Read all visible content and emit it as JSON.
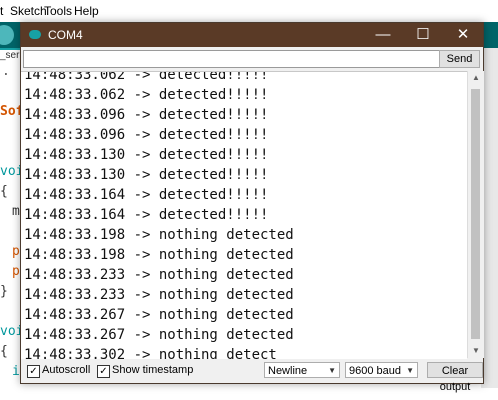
{
  "ide": {
    "menu": [
      "t",
      "Sketch",
      "Tools",
      "Help"
    ],
    "tab_label": "_ser",
    "code_fragments": [
      ".",
      "Sof",
      "voi",
      "{",
      "m",
      "p",
      "p",
      "}",
      "voi",
      "{",
      "i"
    ]
  },
  "window": {
    "title": "COM4",
    "minimize_glyph": "—",
    "maximize_glyph": "☐",
    "close_glyph": "✕"
  },
  "send": {
    "input_value": "",
    "button_label": "Send"
  },
  "output_lines": [
    "14:48:33.062 -> detected!!!!!",
    "14:48:33.062 -> detected!!!!!",
    "14:48:33.096 -> detected!!!!!",
    "14:48:33.096 -> detected!!!!!",
    "14:48:33.130 -> detected!!!!!",
    "14:48:33.130 -> detected!!!!!",
    "14:48:33.164 -> detected!!!!!",
    "14:48:33.164 -> detected!!!!!",
    "14:48:33.198 -> nothing detected",
    "14:48:33.198 -> nothing detected",
    "14:48:33.233 -> nothing detected",
    "14:48:33.233 -> nothing detected",
    "14:48:33.267 -> nothing detected",
    "14:48:33.267 -> nothing detected",
    "14:48:33.302 -> nothing detect"
  ],
  "footer": {
    "autoscroll_label": "Autoscroll",
    "autoscroll_checked": true,
    "timestamp_label": "Show timestamp",
    "timestamp_checked": true,
    "line_ending": "Newline",
    "baud": "9600 baud",
    "clear_label": "Clear output"
  },
  "colors": {
    "titlebar": "#5a3a26",
    "ide_toolbar": "#006468",
    "ide_tabs": "#17a1a5",
    "keyword": "#00979c",
    "type": "#d35400"
  }
}
